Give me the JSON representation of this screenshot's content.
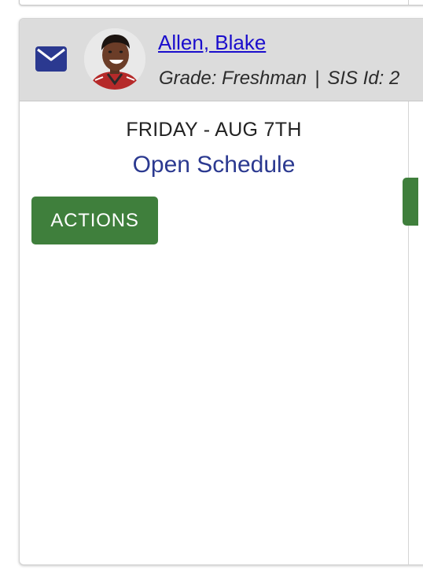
{
  "student": {
    "name": "Allen, Blake",
    "grade_label": "Grade: Freshman",
    "separator": "|",
    "sis_label": "SIS Id: 2"
  },
  "schedule_day": {
    "day_title": "FRIDAY - AUG 7TH",
    "open_schedule_label": "Open Schedule",
    "actions_label": "ACTIONS"
  },
  "icons": {
    "mail": "envelope-icon",
    "avatar": "student-photo"
  },
  "colors": {
    "header_bg": "#dcdcdc",
    "mail_button": "#2b3990",
    "link_name": "#1a0dcc",
    "open_schedule": "#2b3990",
    "actions_button": "#3f7f3c"
  }
}
